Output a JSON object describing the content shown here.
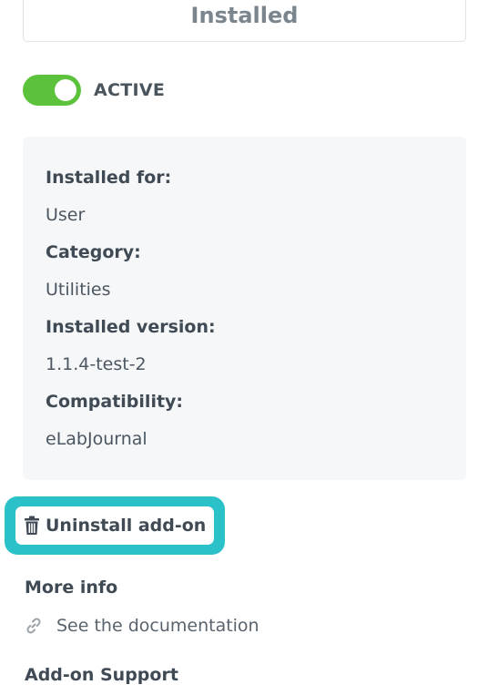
{
  "installed_button": {
    "label": "Installed"
  },
  "status": {
    "label": "ACTIVE",
    "active": true,
    "color": "#5cc23b"
  },
  "info": {
    "items": [
      {
        "label": "Installed for:",
        "value": "User"
      },
      {
        "label": "Category:",
        "value": "Utilities"
      },
      {
        "label": "Installed version:",
        "value": "1.1.4-test-2"
      },
      {
        "label": "Compatibility:",
        "value": "eLabJournal"
      }
    ]
  },
  "uninstall": {
    "label": "Uninstall add-on",
    "icon": "trash-icon",
    "highlight_color": "#2bc1c9"
  },
  "more_info": {
    "title": "More info",
    "documentation_link": {
      "label": "See the documentation",
      "icon": "link-icon"
    }
  },
  "support": {
    "title": "Add-on Support"
  }
}
